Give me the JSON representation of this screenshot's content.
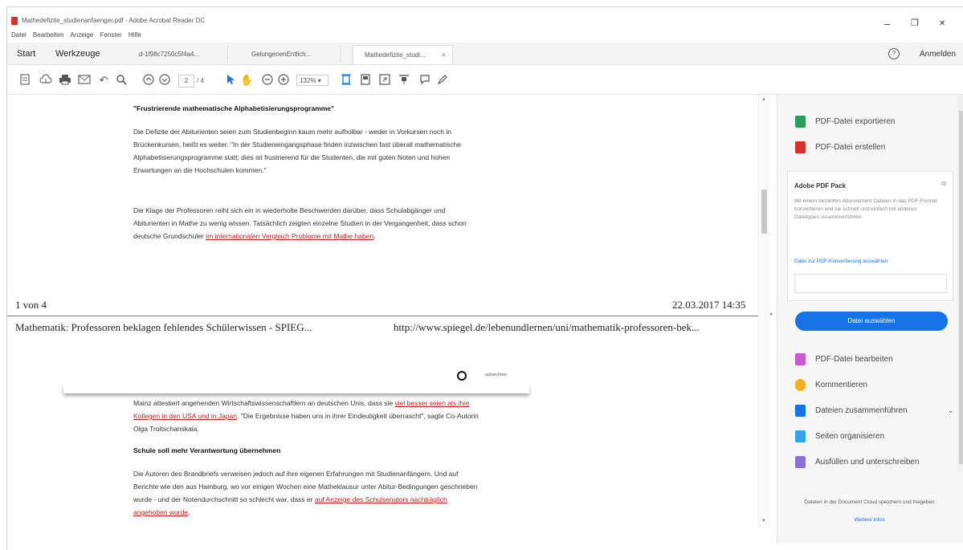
{
  "window": {
    "title": "Mathedefizite_studienanfaenger.pdf - Adobe Acrobat Reader DC",
    "minimize": "–",
    "maximize": "❐",
    "close": "✕"
  },
  "menu": [
    "Datei",
    "Bearbeiten",
    "Anzeige",
    "Fenster",
    "Hilfe"
  ],
  "tabs": {
    "start": "Start",
    "tools": "Werkzeuge",
    "docs": [
      {
        "label": "d-1f98c7250c5f4a4...",
        "active": false
      },
      {
        "label": "GelungenenEntlich...",
        "active": false
      },
      {
        "label": "Mathedefizite_studi...",
        "active": true
      }
    ],
    "close_glyph": "×",
    "help": "?",
    "signin": "Anmelden"
  },
  "toolbar": {
    "page_current": "2",
    "page_total": "/ 4",
    "zoom": "132%"
  },
  "document": {
    "heading1": "\"Frustrierende mathematische Alphabetisierungsprogramme\"",
    "para1": "Die Defizite der Abiturienten seien zum Studienbeginn kaum mehr aufholbar - weder in Vorkursen noch in Brückenkursen, heißt es weiter. \"In der Studieneingangsphase finden inzwischen fast überall mathematische Alphabetisierungsprogramme statt; dies ist frustrierend für die Studenten, die mit guten Noten und hohen Erwartungen an die Hochschulen kommen.\"",
    "para2_text": "Die Klage der Professoren reiht sich ein in wiederholte Beschwerden darüber, dass Schulabgänger und Abiturienten in Mathe zu wenig wissen. Tatsächlich zeigten einzelne Studien in der Vergangenheit, dass schon deutsche Grundschüler ",
    "para2_link": "im internationalen Vergleich Probleme mit Mathe haben",
    "para2_end": ".",
    "footer_page": "1 von 4",
    "footer_date": "22.03.2017 14:35",
    "header_title": "Mathematik: Professoren beklagen fehlendes Schülerwissen - SPIEG...",
    "header_url": "http://www.spiegel.de/lebenundlernen/uni/mathematik-professoren-bek...",
    "record_label": "aufzeichnen",
    "para3_text": "Mainz attestiert angehenden Wirtschaftswissenschaftlern an deutschen Unis, dass sie ",
    "para3_link": "viel besser seien als ihre Kollegen in den USA und in Japan",
    "para3_end": ". \"Die Ergebnisse haben uns in ihrer Eindeutigkeit überrascht\", sagte Co-Autorin Olga Troitschanskaia.",
    "heading2": "Schule soll mehr Verantwortung übernehmen",
    "para4_text": "Die Autoren des Brandbriefs verweisen jedoch auf ihre eigenen Erfahrungen mit Studienanfängern. Und auf Berichte wie den aus Hamburg, wo vor einigen Wochen eine Matheklausur unter Abitur-Bedingungen geschrieben wurde - und der Notendurchschnitt so schlecht war, dass er ",
    "para4_link": "auf Anzeige des Schulsenators nachträglich angehoben wurde",
    "para4_end": "."
  },
  "right_pane": {
    "export_pdf": "PDF-Datei exportieren",
    "create_pdf": "PDF-Datei erstellen",
    "pack_title": "Adobe PDF Pack",
    "pack_desc": "Mit einem bezahlten Abonnement Dateien in das PDF-Format konvertieren und sie schnell und einfach mit anderen Dateitypen zusammenführen.",
    "pack_link": "Datei zur PDF-Konvertierung auswählen",
    "choose_button": "Datei auswählen",
    "edit_pdf": "PDF-Datei bearbeiten",
    "comment": "Kommentieren",
    "combine": "Dateien zusammenführen",
    "organize": "Seiten organisieren",
    "fill_sign": "Ausfüllen und unterschreiben",
    "cloud_text": "Dateien in der Document Cloud speichern und freigeben",
    "more_info": "Weitere Infos"
  },
  "colors": {
    "accent": "#1473e6",
    "link_red": "#b22222",
    "export_icon": "#2d9d5c",
    "create_icon": "#d4322a",
    "edit_icon": "#c75bd1",
    "comment_icon": "#f5b022",
    "combine_icon": "#1473e6",
    "organize_icon": "#33a4e8",
    "fill_icon": "#8a6fd4"
  }
}
